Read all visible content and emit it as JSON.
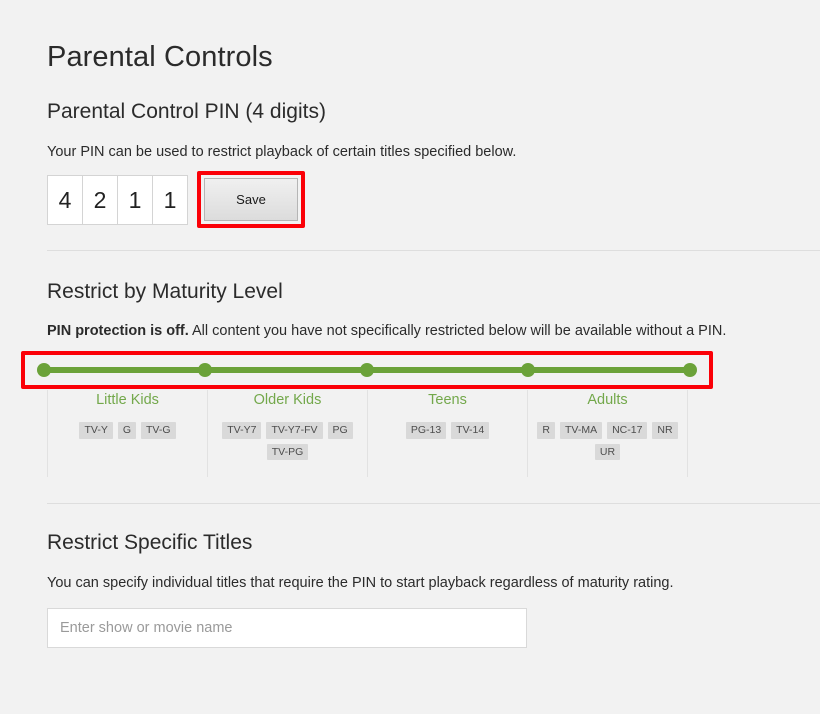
{
  "page": {
    "title": "Parental Controls",
    "background_color": "#f2f2f2",
    "annotation_color": "#fb0007"
  },
  "pin_section": {
    "heading": "Parental Control PIN (4 digits)",
    "description": "Your PIN can be used to restrict playback of certain titles specified below.",
    "digits": [
      "4",
      "2",
      "1",
      "1"
    ],
    "save_label": "Save",
    "save_highlighted": true
  },
  "maturity_section": {
    "heading": "Restrict by Maturity Level",
    "status_bold": "PIN protection is off.",
    "status_rest": " All content you have not specifically restricted below will be available without a PIN.",
    "slider": {
      "stop_count": 5,
      "track_color": "#6ba239",
      "dot_color": "#6ba239",
      "highlighted": true
    },
    "columns": [
      {
        "label": "Little Kids",
        "ratings": [
          "TV-Y",
          "G",
          "TV-G"
        ]
      },
      {
        "label": "Older Kids",
        "ratings": [
          "TV-Y7",
          "TV-Y7-FV",
          "PG",
          "TV-PG"
        ]
      },
      {
        "label": "Teens",
        "ratings": [
          "PG-13",
          "TV-14"
        ]
      },
      {
        "label": "Adults",
        "ratings": [
          "R",
          "TV-MA",
          "NC-17",
          "NR",
          "UR"
        ]
      }
    ],
    "label_color": "#73a84b"
  },
  "titles_section": {
    "heading": "Restrict Specific Titles",
    "description": "You can specify individual titles that require the PIN to start playback regardless of maturity rating.",
    "input_placeholder": "Enter show or movie name",
    "input_value": ""
  }
}
